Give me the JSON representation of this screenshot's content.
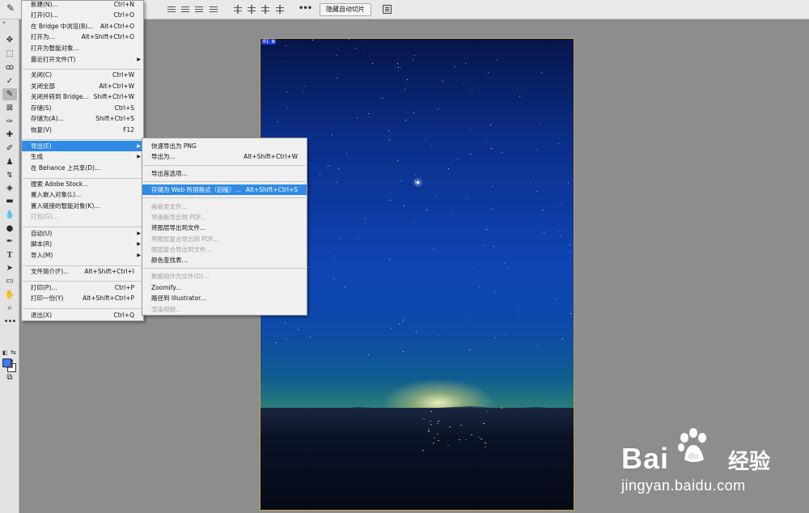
{
  "options_bar": {
    "hide_auto_slices_label": "隐藏自动切片",
    "more_label": "•••"
  },
  "tools": {
    "items": [
      "move",
      "marquee",
      "lasso",
      "quick-select",
      "slice",
      "frame",
      "eyedropper",
      "healing",
      "brush",
      "stamp",
      "history-brush",
      "eraser",
      "gradient",
      "blur",
      "dodge",
      "pen",
      "type",
      "path-select",
      "rectangle",
      "hand",
      "zoom",
      "more"
    ],
    "active": "slice",
    "foreground_color": "#3a78ff",
    "background_color": "#ffffff"
  },
  "canvas": {
    "tag_label": "01 ⊠"
  },
  "file_menu": {
    "items": [
      {
        "label": "新建(N)...",
        "shortcut": "Ctrl+N"
      },
      {
        "label": "打开(O)...",
        "shortcut": "Ctrl+O"
      },
      {
        "label": "在 Bridge 中浏览(B)...",
        "shortcut": "Alt+Ctrl+O"
      },
      {
        "label": "打开为...",
        "shortcut": "Alt+Shift+Ctrl+O"
      },
      {
        "label": "打开为智能对象...",
        "shortcut": ""
      },
      {
        "label": "最近打开文件(T)",
        "shortcut": "",
        "submenu": true
      },
      {
        "label": "关闭(C)",
        "shortcut": "Ctrl+W"
      },
      {
        "label": "关闭全部",
        "shortcut": "Alt+Ctrl+W"
      },
      {
        "label": "关闭并转到 Bridge...",
        "shortcut": "Shift+Ctrl+W"
      },
      {
        "label": "存储(S)",
        "shortcut": "Ctrl+S"
      },
      {
        "label": "存储为(A)...",
        "shortcut": "Shift+Ctrl+S"
      },
      {
        "label": "恢复(V)",
        "shortcut": "F12"
      },
      {
        "label": "导出(E)",
        "shortcut": "",
        "submenu": true,
        "highlighted": true
      },
      {
        "label": "生成",
        "shortcut": "",
        "submenu": true
      },
      {
        "label": "在 Behance 上共享(D)...",
        "shortcut": ""
      },
      {
        "label": "搜索 Adobe Stock...",
        "shortcut": ""
      },
      {
        "label": "置入嵌入对象(L)...",
        "shortcut": ""
      },
      {
        "label": "置入链接的智能对象(K)...",
        "shortcut": ""
      },
      {
        "label": "打包(G)...",
        "shortcut": "",
        "disabled": true
      },
      {
        "label": "自动(U)",
        "shortcut": "",
        "submenu": true
      },
      {
        "label": "脚本(R)",
        "shortcut": "",
        "submenu": true
      },
      {
        "label": "导入(M)",
        "shortcut": "",
        "submenu": true
      },
      {
        "label": "文件简介(F)...",
        "shortcut": "Alt+Shift+Ctrl+I"
      },
      {
        "label": "打印(P)...",
        "shortcut": "Ctrl+P"
      },
      {
        "label": "打印一份(Y)",
        "shortcut": "Alt+Shift+Ctrl+P"
      },
      {
        "label": "退出(X)",
        "shortcut": "Ctrl+Q"
      }
    ]
  },
  "export_menu": {
    "items": [
      {
        "label": "快速导出为 PNG",
        "shortcut": ""
      },
      {
        "label": "导出为...",
        "shortcut": "Alt+Shift+Ctrl+W"
      },
      {
        "label": "导出首选项...",
        "shortcut": ""
      },
      {
        "label": "存储为 Web 所用格式（旧版）...",
        "shortcut": "Alt+Shift+Ctrl+S",
        "highlighted": true
      },
      {
        "label": "画板至文件...",
        "shortcut": "",
        "disabled": true
      },
      {
        "label": "将画板导出到 PDF...",
        "shortcut": "",
        "disabled": true
      },
      {
        "label": "将图层导出到文件...",
        "shortcut": ""
      },
      {
        "label": "将图层复合导出到 PDF...",
        "shortcut": "",
        "disabled": true
      },
      {
        "label": "图层复合导出到文件...",
        "shortcut": "",
        "disabled": true
      },
      {
        "label": "颜色查找表...",
        "shortcut": ""
      },
      {
        "label": "数据组作为文件(D)...",
        "shortcut": "",
        "disabled": true
      },
      {
        "label": "Zoomify...",
        "shortcut": ""
      },
      {
        "label": "路径到 Illustrator...",
        "shortcut": ""
      },
      {
        "label": "渲染视频...",
        "shortcut": "",
        "disabled": true
      }
    ]
  },
  "watermark": {
    "logo_text": "Bai",
    "logo_suffix": "经验",
    "url": "jingyan.baidu.com"
  }
}
